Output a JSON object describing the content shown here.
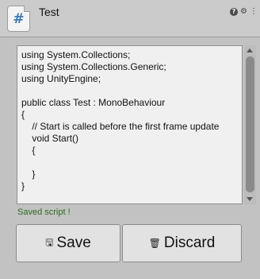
{
  "header": {
    "title": "Test",
    "script_icon_glyph": "#",
    "icons": [
      "help-icon",
      "settings-icon",
      "more-icon"
    ]
  },
  "editor": {
    "code": "using System.Collections;\nusing System.Collections.Generic;\nusing UnityEngine;\n\npublic class Test : MonoBehaviour\n{\n    // Start is called before the first frame update\n    void Start()\n    {\n\n    }\n}"
  },
  "status": {
    "text": "Saved script !"
  },
  "buttons": {
    "save_label": "Save",
    "save_icon": "floppy-disk-icon",
    "discard_label": "Discard",
    "discard_icon": "trash-icon"
  },
  "colors": {
    "panel_bg": "#c2c2c2",
    "editor_bg": "#f0f0f0",
    "status_green": "#2d6a1e",
    "icon_blue": "#3d78b0"
  }
}
